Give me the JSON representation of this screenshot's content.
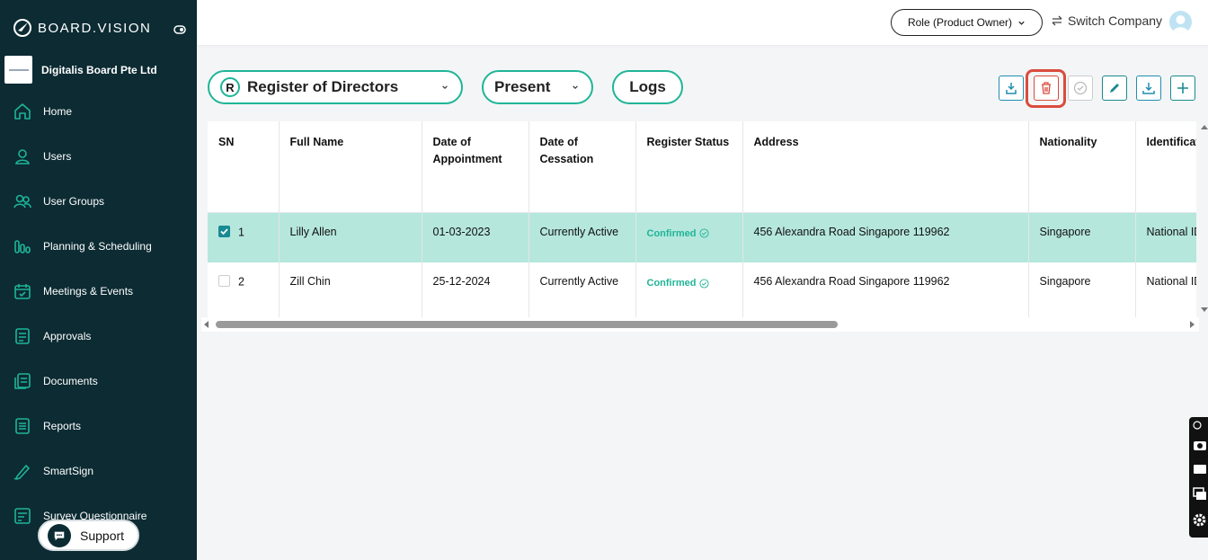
{
  "brand": {
    "name": "BOARD.VISION"
  },
  "company": {
    "name": "Digitalis Board Pte Ltd"
  },
  "sidebar": {
    "items": [
      {
        "label": "Home",
        "icon": "home-icon"
      },
      {
        "label": "Users",
        "icon": "user-icon"
      },
      {
        "label": "User Groups",
        "icon": "user-groups-icon"
      },
      {
        "label": "Planning & Scheduling",
        "icon": "planning-icon"
      },
      {
        "label": "Meetings & Events",
        "icon": "calendar-icon"
      },
      {
        "label": "Approvals",
        "icon": "approvals-icon"
      },
      {
        "label": "Documents",
        "icon": "documents-icon"
      },
      {
        "label": "Reports",
        "icon": "reports-icon"
      },
      {
        "label": "SmartSign",
        "icon": "pen-icon"
      },
      {
        "label": "Survey Questionnaire",
        "icon": "survey-icon"
      }
    ]
  },
  "support": {
    "label": "Support"
  },
  "header": {
    "role_label": "Role (Product Owner)",
    "switch_label": "Switch Company"
  },
  "toolbar": {
    "register_badge": "R",
    "register_label": "Register of Directors",
    "period_label": "Present",
    "logs_label": "Logs",
    "actions": [
      "import-icon",
      "trash-icon",
      "check-circle-icon",
      "edit-icon",
      "download-icon",
      "plus-icon"
    ]
  },
  "table": {
    "columns": {
      "sn": "SN",
      "full_name": "Full Name",
      "appointment": "Date of Appointment",
      "cessation": "Date of Cessation",
      "status": "Register Status",
      "address": "Address",
      "nationality": "Nationality",
      "id_type": "Identification Type"
    },
    "rows": [
      {
        "checked": true,
        "sn": "1",
        "full_name": "Lilly Allen",
        "appointment": "01-03-2023",
        "cessation": "Currently Active",
        "status": "Confirmed",
        "address": "456 Alexandra Road Singapore 119962",
        "nationality": "Singapore",
        "id_type": "National ID"
      },
      {
        "checked": false,
        "sn": "2",
        "full_name": "Zill Chin",
        "appointment": "25-12-2024",
        "cessation": "Currently Active",
        "status": "Confirmed",
        "address": "456 Alexandra Road Singapore 119962",
        "nationality": "Singapore",
        "id_type": "National ID"
      }
    ]
  },
  "colors": {
    "sidebar": "#0c2b33",
    "accent": "#1fb597",
    "selected_row": "#b5e7dd",
    "highlight": "#d94c3d"
  }
}
